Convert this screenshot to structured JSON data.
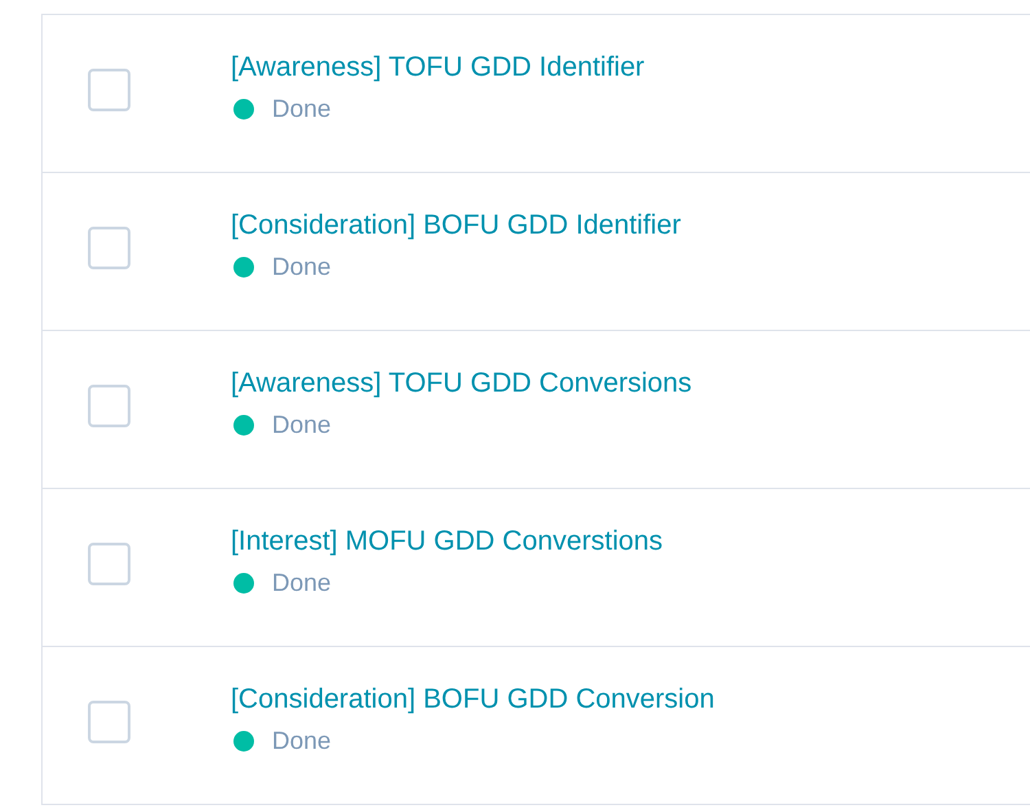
{
  "rows": [
    {
      "title": "[Awareness] TOFU GDD Identifier",
      "status": "Done",
      "color": "#00bda5",
      "checked": false
    },
    {
      "title": "[Consideration] BOFU GDD Identifier",
      "status": "Done",
      "color": "#00bda5",
      "checked": false
    },
    {
      "title": "[Awareness] TOFU GDD Conversions",
      "status": "Done",
      "color": "#00bda5",
      "checked": false
    },
    {
      "title": "[Interest] MOFU GDD Converstions",
      "status": "Done",
      "color": "#00bda5",
      "checked": false
    },
    {
      "title": "[Consideration] BOFU GDD Conversion",
      "status": "Done",
      "color": "#00bda5",
      "checked": false
    }
  ]
}
